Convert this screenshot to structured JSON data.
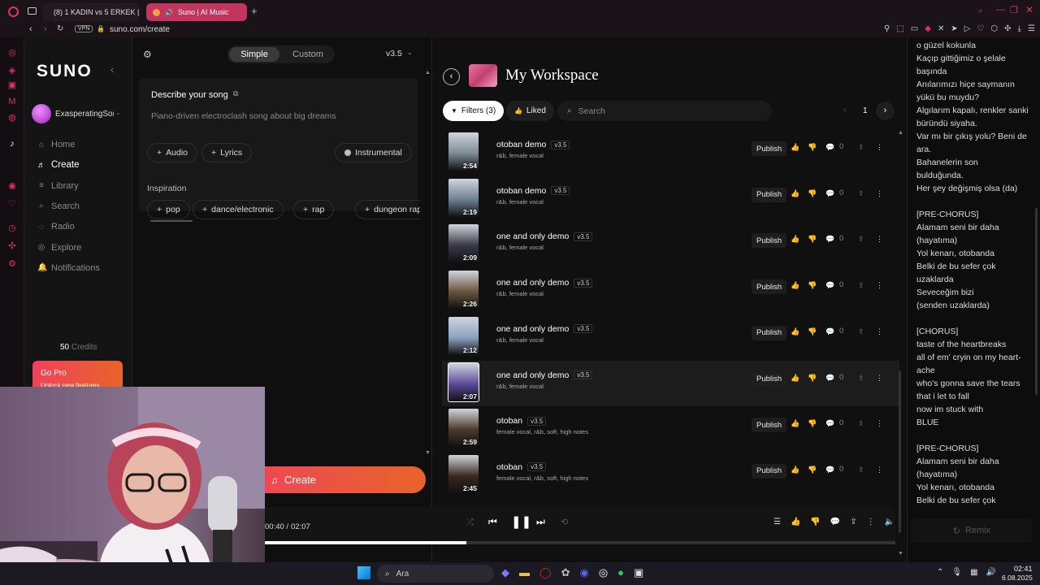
{
  "browser": {
    "tabs": [
      {
        "label": "(8) 1 KADIN vs 5 ERKEK |"
      },
      {
        "label": "Suno | AI Music"
      }
    ],
    "vpn": "VPN",
    "url": "suno.com/create"
  },
  "sidebar": {
    "logo": "SUNO",
    "username": "ExasperatingSon",
    "nav": [
      {
        "label": "Home",
        "icon": "home-icon"
      },
      {
        "label": "Create",
        "icon": "music-note-icon"
      },
      {
        "label": "Library",
        "icon": "library-icon"
      },
      {
        "label": "Search",
        "icon": "search-icon"
      },
      {
        "label": "Radio",
        "icon": "radio-icon"
      },
      {
        "label": "Explore",
        "icon": "compass-icon"
      },
      {
        "label": "Notifications",
        "icon": "bell-icon"
      }
    ],
    "credits_count": "50",
    "credits_label": "Credits",
    "gopro_title": "Go Pro",
    "gopro_sub": "Unlock new features"
  },
  "create": {
    "mode_simple": "Simple",
    "mode_custom": "Custom",
    "model": "v3.5",
    "describe_label": "Describe your song",
    "prompt_text": "Piano-driven electroclash song about big dreams",
    "audio_label": "Audio",
    "lyrics_label": "Lyrics",
    "instrumental_label": "Instrumental",
    "inspiration_label": "Inspiration",
    "inspiration_tags": [
      "pop",
      "dance/electronic",
      "rap",
      "dungeon rap"
    ],
    "create_button": "Create"
  },
  "workspace": {
    "title": "My Workspace",
    "filters_label": "Filters (3)",
    "liked_label": "Liked",
    "search_placeholder": "Search",
    "page": "1",
    "publish_label": "Publish",
    "songs": [
      {
        "title": "otoban demo",
        "version": "v3.5",
        "tags": "r&b, female vocal",
        "duration": "2:54",
        "comments": "0",
        "liked": false,
        "thumb": "#7d8a94"
      },
      {
        "title": "otoban demo",
        "version": "v3.5",
        "tags": "r&b, female vocal",
        "duration": "2:19",
        "comments": "0",
        "liked": false,
        "thumb": "#6c7f90"
      },
      {
        "title": "one and only demo",
        "version": "v3.5",
        "tags": "r&b, female vocal",
        "duration": "2:09",
        "comments": "0",
        "liked": false,
        "thumb": "#3a3a48"
      },
      {
        "title": "one and only demo",
        "version": "v3.5",
        "tags": "r&b, female vocal",
        "duration": "2:26",
        "comments": "0",
        "liked": false,
        "thumb": "#6a5440"
      },
      {
        "title": "one and only demo",
        "version": "v3.5",
        "tags": "r&b, female vocal",
        "duration": "2:12",
        "comments": "0",
        "liked": false,
        "thumb": "#8ca0c0"
      },
      {
        "title": "one and only demo",
        "version": "v3.5",
        "tags": "r&b, female vocal",
        "duration": "2:07",
        "comments": "0",
        "liked": true,
        "thumb": "#5a4a9a"
      },
      {
        "title": "otoban",
        "version": "v3.5",
        "tags": "female vocal, r&b, soft, high notes",
        "duration": "2:59",
        "comments": "0",
        "liked": false,
        "thumb": "#4a3a2a"
      },
      {
        "title": "otoban",
        "version": "v3.5",
        "tags": "female vocal, r&b, soft, high notes",
        "duration": "2:45",
        "comments": "0",
        "liked": false,
        "thumb": "#3a2a1e"
      }
    ]
  },
  "lyrics": {
    "lines": [
      "o güzel kokunla",
      "Kaçıp gittiğimiz o şelale",
      "başında",
      "Anılarımızı hiçe saymanın",
      "yükü bu muydu?",
      "Algılarım kapalı, renkler sanki",
      "büründü siyaha.",
      "Var mı bir çıkış yolu? Beni de",
      "ara.",
      "Bahanelerin son",
      "bulduğunda.",
      "Her şey değişmiş olsa (da)",
      "",
      "[PRE-CHORUS]",
      "Alamam seni bir daha",
      "(hayatıma)",
      "Yol kenarı, otobanda",
      "Belki de bu sefer çok",
      "uzaklarda",
      "Seveceğim bizi",
      "(senden uzaklarda)",
      "",
      "[CHORUS]",
      "taste of the heartbreaks",
      "all of em' cryin on my heart-",
      "ache",
      "who's gonna save the tears",
      "that i let to fall",
      "now im stuck with",
      "BLUE",
      "",
      "[PRE-CHORUS]",
      "Alamam seni bir daha",
      "(hayatıma)",
      "Yol kenarı, otobanda",
      "Belki de bu sefer çok"
    ],
    "remix_label": "Remix"
  },
  "player": {
    "current_time": "00:40 /",
    "total_time": "02:07",
    "progress": 0.32
  },
  "taskbar": {
    "search_placeholder": "Ara",
    "time": "02:41",
    "date": "6.08.2025"
  },
  "colors": {
    "accent": "#e0306a",
    "create_grad_start": "#f0425c",
    "create_grad_end": "#e8642a"
  }
}
